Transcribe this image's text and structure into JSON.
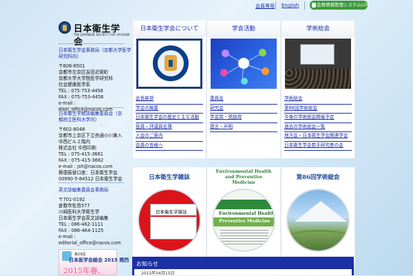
{
  "topnav": {
    "members_link": "会員専用",
    "english_link": "English",
    "login_button": "会員情報管理システムLOGIN"
  },
  "logo": {
    "name_jp": "日本衛生学会",
    "name_en": "THE JAPANESE SOCIETY FOR HYGIENE"
  },
  "sections": [
    {
      "heading": "日本衛生学会事務局（京都大学医学研究科内）",
      "lines": [
        "〒606-8501",
        "京都市左京区吉田近衛町",
        "京都大学大学院医学研究科",
        "社会健康医学系",
        "TEL : 075-753-4456",
        "FAX : 075-753-4458",
        "e-mail :",
        "eisei_office@nacos.com"
      ]
    },
    {
      "heading": "日本衛生学雑誌編集委員会（京都府立医科大学内）",
      "lines": [
        "〒602-8048",
        "京都市上京区下立売通小川東入",
        "中西ビル２階内",
        "株式会社 中西印刷",
        "TEL : 075-415-3661",
        "FAX : 075-415-3662",
        "e-mail : jsh@nacos.com",
        "郵便振替口座：日本衛生学会",
        "00990-5-84512 日本衛生学会"
      ]
    },
    {
      "heading": "英文誌編集委員会事務局",
      "lines": [
        "〒701-0192",
        "倉敷市松島577",
        "川崎医科大学衛生学",
        "日本衛生学会英文誌編集",
        "TEL : 086-462-1111",
        "FAX : 086-464-1125",
        "e-mail :",
        "editorial_office@nacos.com"
      ]
    }
  ],
  "banner": {
    "line1": "第29回",
    "line2": "日本医学会総会 2015 関西",
    "line3": "2015年春、"
  },
  "cards": [
    {
      "title": "日本衛生学会について",
      "image": "society-seal-image",
      "links": [
        "会長挨拶",
        "学会の概要",
        "日本衛生学会の歴史と主な活動",
        "役員・評議員名簿",
        "入会のご案内",
        "会員の皆様へ"
      ]
    },
    {
      "title": "学会活動",
      "image": "network-diagram-image",
      "links": [
        "委員会",
        "研究会",
        "学会賞・奨励賞",
        "提言・声明"
      ]
    },
    {
      "title": "学術総会",
      "image": "conference-hall-image",
      "links": [
        "学術総会",
        "第86回学術総会",
        "今後の学術総会開催予定",
        "過去の学術総会一覧",
        "地方会・日本衛生学会関連学会",
        "日本衛生学会若手研究者の会"
      ]
    }
  ],
  "features": [
    {
      "title": "日本衛生学雑誌",
      "cover_text": "日本衛生学雑誌"
    },
    {
      "title": "Environmental Health and Preventive Medicine",
      "cover_line1": "Environmental Health",
      "cover_line2": "Preventive Medicine"
    },
    {
      "title": "第86回学術総会"
    }
  ],
  "news": {
    "heading": "お知らせ",
    "first_row": "2015年04月15日"
  },
  "colors": {
    "link": "#1c2fa8",
    "login_green": "#3c9a3a",
    "news_blue": "#1b2fa6"
  }
}
